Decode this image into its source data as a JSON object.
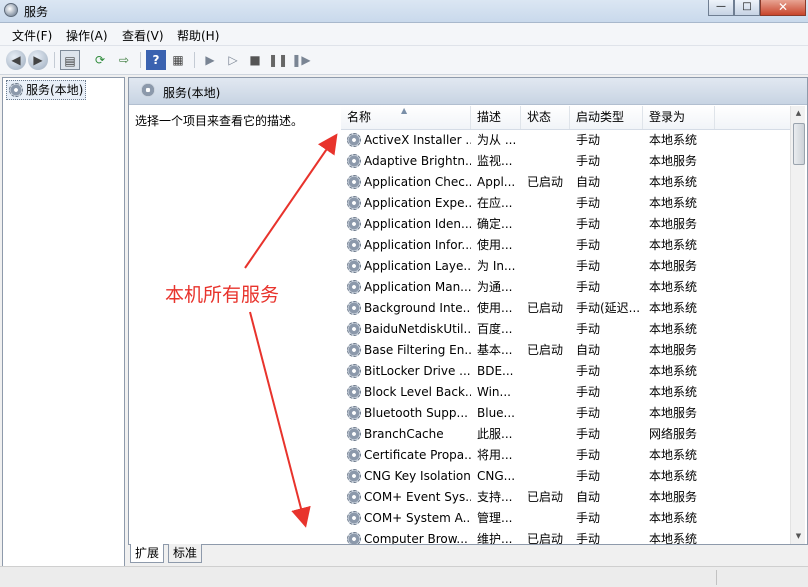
{
  "window": {
    "title": "服务"
  },
  "menu": [
    "文件(F)",
    "操作(A)",
    "查看(V)",
    "帮助(H)"
  ],
  "toolbar_icons": [
    "back-icon",
    "forward-icon",
    "show-hide-tree-icon",
    "refresh-icon",
    "export-list-icon",
    "help-icon",
    "properties-icon",
    "start-service-icon",
    "start-service-alt-icon",
    "stop-service-icon",
    "pause-service-icon",
    "restart-service-icon"
  ],
  "left": {
    "tree_root": "服务(本地)"
  },
  "main": {
    "header": "服务(本地)",
    "description_prompt": "选择一个项目来查看它的描述。",
    "columns": [
      "名称",
      "描述",
      "状态",
      "启动类型",
      "登录为"
    ],
    "rows": [
      {
        "name": "ActiveX Installer ...",
        "desc": "为从 ...",
        "status": "",
        "startup": "手动",
        "logon": "本地系统"
      },
      {
        "name": "Adaptive Brightn...",
        "desc": "监视...",
        "status": "",
        "startup": "手动",
        "logon": "本地服务"
      },
      {
        "name": "Application Chec...",
        "desc": "Appl...",
        "status": "已启动",
        "startup": "自动",
        "logon": "本地系统"
      },
      {
        "name": "Application Expe...",
        "desc": "在应...",
        "status": "",
        "startup": "手动",
        "logon": "本地系统"
      },
      {
        "name": "Application Iden...",
        "desc": "确定...",
        "status": "",
        "startup": "手动",
        "logon": "本地服务"
      },
      {
        "name": "Application Infor...",
        "desc": "使用...",
        "status": "",
        "startup": "手动",
        "logon": "本地系统"
      },
      {
        "name": "Application Laye...",
        "desc": "为 In...",
        "status": "",
        "startup": "手动",
        "logon": "本地服务"
      },
      {
        "name": "Application Man...",
        "desc": "为通...",
        "status": "",
        "startup": "手动",
        "logon": "本地系统"
      },
      {
        "name": "Background Inte...",
        "desc": "使用...",
        "status": "已启动",
        "startup": "手动(延迟...",
        "logon": "本地系统"
      },
      {
        "name": "BaiduNetdiskUtil...",
        "desc": "百度...",
        "status": "",
        "startup": "手动",
        "logon": "本地系统"
      },
      {
        "name": "Base Filtering En...",
        "desc": "基本...",
        "status": "已启动",
        "startup": "自动",
        "logon": "本地服务"
      },
      {
        "name": "BitLocker Drive ...",
        "desc": "BDE...",
        "status": "",
        "startup": "手动",
        "logon": "本地系统"
      },
      {
        "name": "Block Level Back...",
        "desc": "Win...",
        "status": "",
        "startup": "手动",
        "logon": "本地系统"
      },
      {
        "name": "Bluetooth Supp...",
        "desc": "Blue...",
        "status": "",
        "startup": "手动",
        "logon": "本地服务"
      },
      {
        "name": "BranchCache",
        "desc": "此服...",
        "status": "",
        "startup": "手动",
        "logon": "网络服务"
      },
      {
        "name": "Certificate Propa...",
        "desc": "将用...",
        "status": "",
        "startup": "手动",
        "logon": "本地系统"
      },
      {
        "name": "CNG Key Isolation",
        "desc": "CNG...",
        "status": "",
        "startup": "手动",
        "logon": "本地系统"
      },
      {
        "name": "COM+ Event Sys...",
        "desc": "支持...",
        "status": "已启动",
        "startup": "自动",
        "logon": "本地服务"
      },
      {
        "name": "COM+ System A...",
        "desc": "管理...",
        "status": "",
        "startup": "手动",
        "logon": "本地系统"
      },
      {
        "name": "Computer Brow...",
        "desc": "维护...",
        "status": "已启动",
        "startup": "手动",
        "logon": "本地系统"
      }
    ]
  },
  "tabs": [
    "扩展",
    "标准"
  ],
  "annotation": {
    "text": "本机所有服务",
    "color": "#e8332c"
  },
  "colors": {
    "arrow": "#e8332c",
    "header_bg": "#c8d4e3",
    "border": "#8e9aab"
  }
}
